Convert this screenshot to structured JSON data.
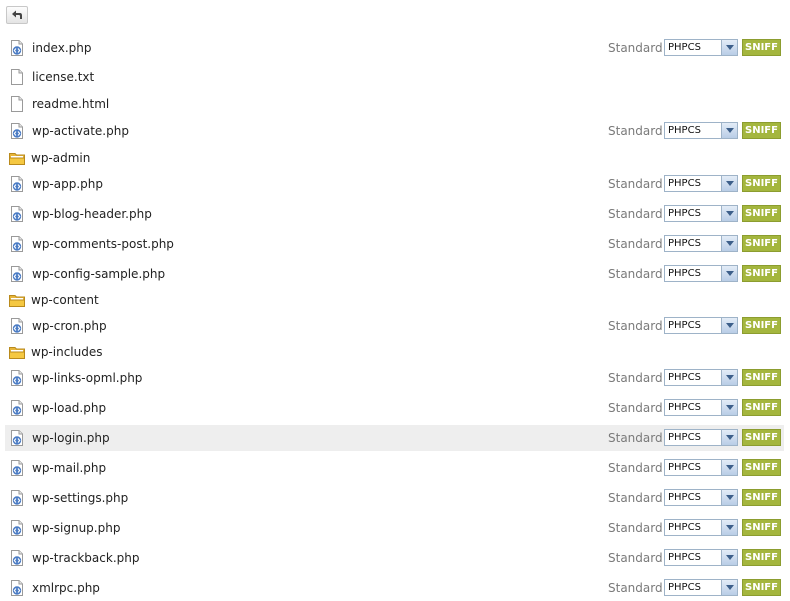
{
  "toolbar": {
    "back_icon": "arrow-back-icon"
  },
  "labels": {
    "standard": "Standard:",
    "sniff": "SNIFF"
  },
  "colors": {
    "sniff_bg": "#a4b63e",
    "folder": "#f5c842",
    "php_badge": "#4a7bc4",
    "row_highlight": "#eeeeee"
  },
  "files": [
    {
      "name": "index.php",
      "type": "php",
      "standard": "PHPCS"
    },
    {
      "name": "license.txt",
      "type": "text"
    },
    {
      "name": "readme.html",
      "type": "text"
    },
    {
      "name": "wp-activate.php",
      "type": "php",
      "standard": "PHPCS"
    },
    {
      "name": "wp-admin",
      "type": "folder"
    },
    {
      "name": "wp-app.php",
      "type": "php",
      "standard": "PHPCS"
    },
    {
      "name": "wp-blog-header.php",
      "type": "php",
      "standard": "PHPCS"
    },
    {
      "name": "wp-comments-post.php",
      "type": "php",
      "standard": "PHPCS"
    },
    {
      "name": "wp-config-sample.php",
      "type": "php",
      "standard": "PHPCS"
    },
    {
      "name": "wp-content",
      "type": "folder"
    },
    {
      "name": "wp-cron.php",
      "type": "php",
      "standard": "PHPCS"
    },
    {
      "name": "wp-includes",
      "type": "folder"
    },
    {
      "name": "wp-links-opml.php",
      "type": "php",
      "standard": "PHPCS"
    },
    {
      "name": "wp-load.php",
      "type": "php",
      "standard": "PHPCS"
    },
    {
      "name": "wp-login.php",
      "type": "php",
      "standard": "PHPCS",
      "highlighted": true
    },
    {
      "name": "wp-mail.php",
      "type": "php",
      "standard": "PHPCS"
    },
    {
      "name": "wp-settings.php",
      "type": "php",
      "standard": "PHPCS"
    },
    {
      "name": "wp-signup.php",
      "type": "php",
      "standard": "PHPCS"
    },
    {
      "name": "wp-trackback.php",
      "type": "php",
      "standard": "PHPCS"
    },
    {
      "name": "xmlrpc.php",
      "type": "php",
      "standard": "PHPCS"
    }
  ]
}
